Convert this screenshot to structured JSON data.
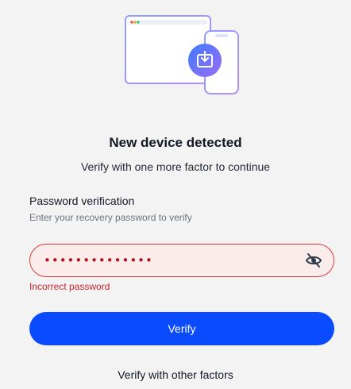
{
  "page": {
    "title": "New device detected",
    "subtitle": "Verify with one more factor to continue"
  },
  "illustration": {
    "icon": "new-device-download-icon",
    "colors": [
      "#7c8cff",
      "#a78bfa",
      "#3b82f6"
    ]
  },
  "password_section": {
    "title": "Password verification",
    "hint": "Enter your recovery password to verify",
    "value": "••••••••••••••",
    "toggle_icon": "eye-slash-icon",
    "error": "Incorrect password"
  },
  "actions": {
    "verify_label": "Verify",
    "other_factors_label": "Verify with other factors"
  },
  "colors": {
    "primary": "#0a4bff",
    "error": "#c8232a",
    "error_background": "#fbecec"
  }
}
